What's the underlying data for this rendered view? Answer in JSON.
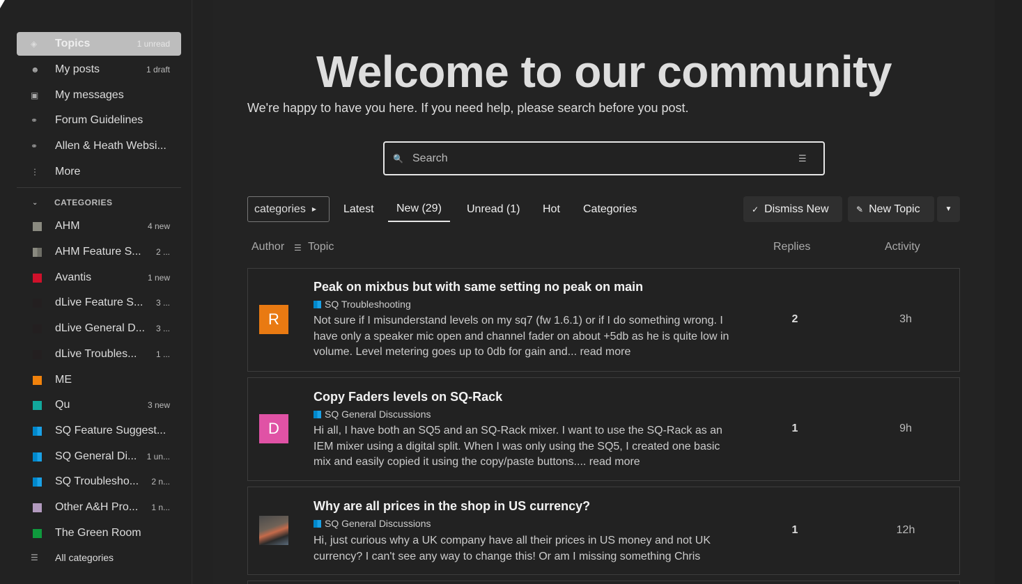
{
  "sidebar": {
    "items": [
      {
        "icon": "layers-icon",
        "label": "Topics",
        "count": "1 unread"
      },
      {
        "icon": "user-icon",
        "label": "My posts",
        "count": "1 draft"
      },
      {
        "icon": "inbox-icon",
        "label": "My messages",
        "count": ""
      },
      {
        "icon": "link-icon",
        "label": "Forum Guidelines",
        "count": ""
      },
      {
        "icon": "link-icon",
        "label": "Allen & Heath Websi...",
        "count": ""
      },
      {
        "icon": "more-vertical-icon",
        "label": "More",
        "count": ""
      }
    ],
    "categories_heading": "CATEGORIES",
    "categories": [
      {
        "label": "AHM",
        "count": "4 new",
        "color": "#8a8a80"
      },
      {
        "label": "AHM Feature S...",
        "count": "2 ...",
        "color": "#8a8a80",
        "color2": "#6e6e66"
      },
      {
        "label": "Avantis",
        "count": "1 new",
        "color": "#d0112b"
      },
      {
        "label": "dLive Feature S...",
        "count": "3 ...",
        "color": "#231f20"
      },
      {
        "label": "dLive General D...",
        "count": "3 ...",
        "color": "#231f20"
      },
      {
        "label": "dLive Troubles...",
        "count": "1 ...",
        "color": "#231f20"
      },
      {
        "label": "ME",
        "count": "",
        "color": "#f1820c"
      },
      {
        "label": "Qu",
        "count": "3 new",
        "color": "#12a89d"
      },
      {
        "label": "SQ Feature Suggest...",
        "count": "",
        "color": "#0088cc",
        "color2": "#1aa1e6"
      },
      {
        "label": "SQ General Di...",
        "count": "1 un...",
        "color": "#0088cc",
        "color2": "#1aa1e6"
      },
      {
        "label": "SQ Troublesho...",
        "count": "2 n...",
        "color": "#0088cc",
        "color2": "#1aa1e6"
      },
      {
        "label": "Other A&H Pro...",
        "count": "1 n...",
        "color": "#b39bbf"
      },
      {
        "label": "The Green Room",
        "count": "",
        "color": "#0f9a3d"
      }
    ],
    "all_categories": "All categories"
  },
  "banner": {
    "title": "Welcome to our community",
    "subtitle": "We're happy to have you here. If you need help, please search before you post."
  },
  "search": {
    "placeholder": "Search"
  },
  "nav": {
    "categories_dropdown": "categories",
    "links": [
      "Latest",
      "New (29)",
      "Unread (1)",
      "Hot",
      "Categories"
    ],
    "dismiss_label": "Dismiss New",
    "new_topic_label": "New Topic"
  },
  "table": {
    "col_author": "Author",
    "col_topic": "Topic",
    "col_replies": "Replies",
    "col_activity": "Activity"
  },
  "topics": [
    {
      "title": "Peak on mixbus but with same setting no peak on main",
      "category": "SQ Troubleshooting",
      "excerpt": "Not sure if I misunderstand levels on my sq7 (fw 1.6.1) or if I do something wrong. I have only a speaker mic open and channel fader on about +5db as he is quite low in volume. Level metering goes up to 0db for gain and... read more",
      "replies": "2",
      "activity": "3h",
      "avatar_letter": "R",
      "avatar_color": "#e97a12"
    },
    {
      "title": "Copy Faders levels on SQ-Rack",
      "category": "SQ General Discussions",
      "excerpt": "Hi all, I have both an SQ5 and an SQ-Rack mixer. I want to use the SQ-Rack as an IEM mixer using a digital split. When I was only using the SQ5, I created one basic mix and easily copied it using the copy/paste buttons.... read more",
      "replies": "1",
      "activity": "9h",
      "avatar_letter": "D",
      "avatar_color": "#e052a5"
    },
    {
      "title": "Why are all prices in the shop in US currency?",
      "category": "SQ General Discussions",
      "excerpt": "Hi, just curious why a UK company have all their prices in US money and not UK currency? I can't see any way to change this! Or am I missing something Chris",
      "replies": "1",
      "activity": "12h",
      "avatar_letter": "",
      "avatar_color": ""
    }
  ]
}
